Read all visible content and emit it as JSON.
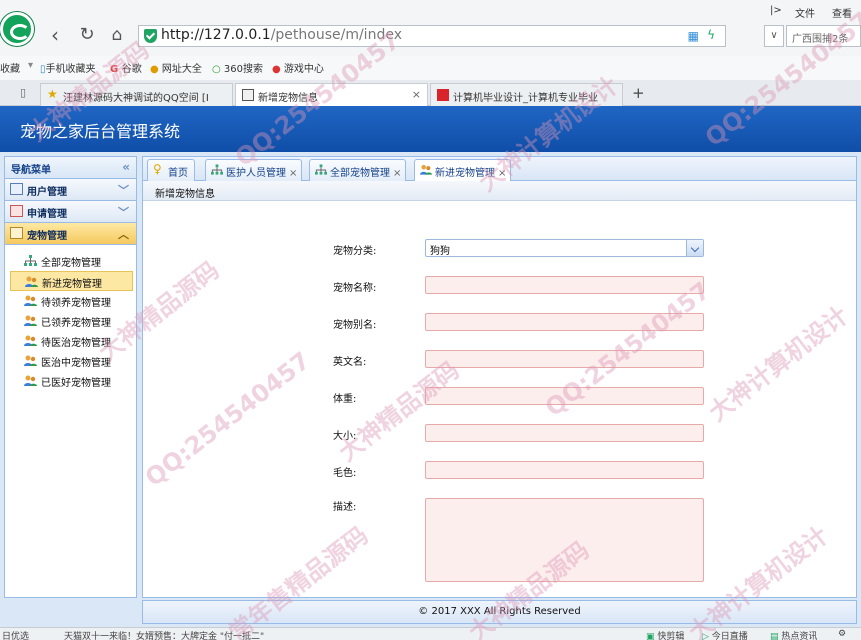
{
  "browser": {
    "menu_file": "文件",
    "menu_view": "查看",
    "url_host": "http://127.0.0.1",
    "url_path": "/pethouse/m/index",
    "search_placeholder": "广西围捕2条",
    "bookmarks": [
      "收藏",
      "手机收藏夹",
      "谷歌",
      "网址大全",
      "360搜索",
      "游戏中心"
    ],
    "tabs": [
      {
        "label": "汪建林源码大神调试的QQ空间 [I"
      },
      {
        "label": "新增宠物信息"
      },
      {
        "label": "计算机毕业设计_计算机专业毕业"
      }
    ],
    "new_tab": "+"
  },
  "app": {
    "title": "宠物之家后台管理系统",
    "sidebar": {
      "title": "导航菜单",
      "sections": [
        {
          "label": "用户管理"
        },
        {
          "label": "申请管理"
        },
        {
          "label": "宠物管理"
        }
      ],
      "items": [
        {
          "label": "全部宠物管理"
        },
        {
          "label": "新进宠物管理"
        },
        {
          "label": "待领养宠物管理"
        },
        {
          "label": "已领养宠物管理"
        },
        {
          "label": "待医治宠物管理"
        },
        {
          "label": "医治中宠物管理"
        },
        {
          "label": "已医好宠物管理"
        }
      ]
    },
    "tabs": [
      {
        "label": "首页"
      },
      {
        "label": "医护人员管理"
      },
      {
        "label": "全部宠物管理"
      },
      {
        "label": "新进宠物管理"
      }
    ],
    "tab_close": "×",
    "panel_title": "新增宠物信息",
    "form": {
      "category_label": "宠物分类:",
      "category_value": "狗狗",
      "name_label": "宠物名称:",
      "alias_label": "宠物别名:",
      "english_label": "英文名:",
      "weight_label": "体重:",
      "size_label": "大小:",
      "color_label": "毛色:",
      "desc_label": "描述:"
    },
    "footer": "© 2017 XXX All Rights Reserved"
  },
  "status_bar": {
    "left1": "日优选",
    "left2": "天猫双十一来临！女婿预售：大牌定金 \"付一抵二\"",
    "right1": "快剪辑",
    "right2": "今日直播",
    "right3": "热点资讯"
  },
  "watermark": {
    "qq": "QQ:254540457",
    "source": "大神精品源码",
    "design": "大神计算机设计",
    "seller": "常年售精品源码"
  },
  "colors": {
    "header_blue": "#1559b8",
    "required_field_bg": "#fdeeee",
    "selected_item": "#fce7a3"
  }
}
